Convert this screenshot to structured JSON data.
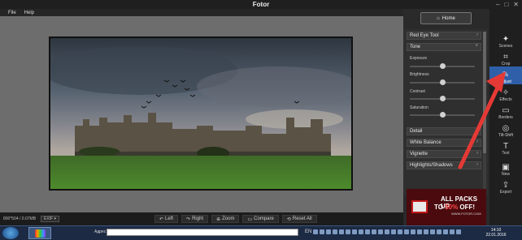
{
  "window": {
    "title": "Fotor",
    "controls": [
      "–",
      "□",
      "✕"
    ]
  },
  "menu": {
    "items": [
      "File",
      "Help"
    ]
  },
  "status": {
    "image_info": "800*504 / 0.07MB",
    "exif_label": "EXIF ▾"
  },
  "bottom_tools": [
    {
      "icon": "rotate-left-icon",
      "glyph": "↶",
      "label": "Left"
    },
    {
      "icon": "rotate-right-icon",
      "glyph": "↷",
      "label": "Right"
    },
    {
      "icon": "zoom-icon",
      "glyph": "⊕",
      "label": "Zoom"
    },
    {
      "icon": "compare-icon",
      "glyph": "▭",
      "label": "Compare"
    },
    {
      "icon": "reset-icon",
      "glyph": "⟲",
      "label": "Reset All"
    }
  ],
  "home": {
    "label": "Home"
  },
  "panel": {
    "red_eye": "Red Eye Tool",
    "tone": "Tone",
    "sliders": [
      {
        "label": "Exposure",
        "value": 0.5
      },
      {
        "label": "Brightness",
        "value": 0.5
      },
      {
        "label": "Contrast",
        "value": 0.5
      },
      {
        "label": "Saturation",
        "value": 0.5
      }
    ],
    "sections": [
      "Detail",
      "White Balance",
      "Vignette",
      "Highlights/Shadows"
    ]
  },
  "ad": {
    "line1": "ALL PACKS UP",
    "line2_prefix": "TO ",
    "line2_highlight": "50%",
    "line2_suffix": " OFF!",
    "site": "WWW.FOTOR.COM"
  },
  "sidebar": {
    "items": [
      {
        "label": "Scenes",
        "glyph": "✦",
        "active": false
      },
      {
        "label": "Crop",
        "glyph": "⌗",
        "active": false
      },
      {
        "label": "Adjust",
        "glyph": "✎",
        "active": true
      },
      {
        "label": "Effects",
        "glyph": "✧",
        "active": false
      },
      {
        "label": "Borders",
        "glyph": "▭",
        "active": false
      },
      {
        "label": "Tilt-Shift",
        "glyph": "◎",
        "active": false
      },
      {
        "label": "Text",
        "glyph": "T",
        "active": false
      },
      {
        "label": "New",
        "glyph": "▣",
        "active": false
      },
      {
        "label": "Export",
        "glyph": "⇪",
        "active": false
      }
    ]
  },
  "taskbar": {
    "address_label": "Адрес",
    "lang": "EN",
    "time": "14:10",
    "date": "22.01.2016"
  },
  "colors": {
    "accent": "#2f5fa8",
    "arrow": "#e53935",
    "ad_bg": "#4a0a0e"
  }
}
